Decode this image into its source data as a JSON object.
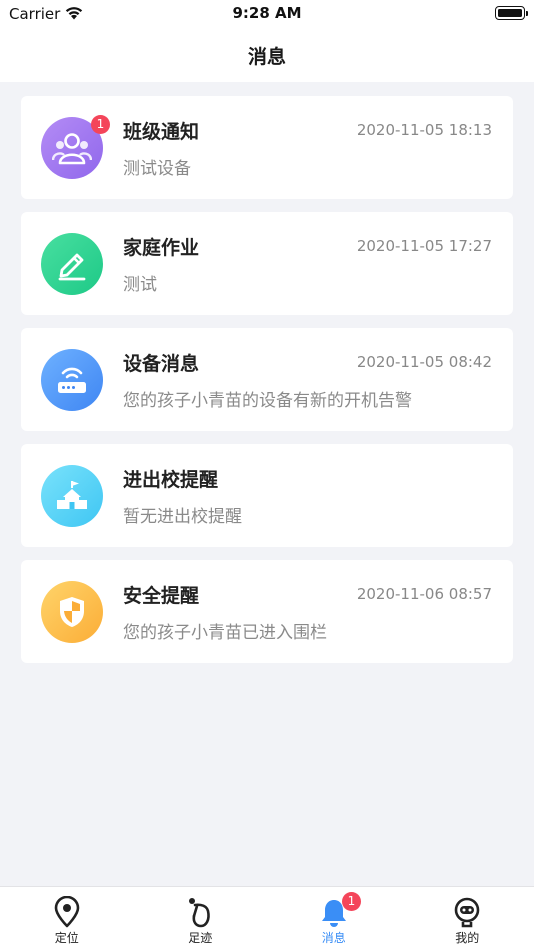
{
  "status_bar": {
    "carrier": "Carrier",
    "time": "9:28 AM"
  },
  "nav": {
    "title": "消息"
  },
  "messages": [
    {
      "name": "班级通知",
      "time": "2020-11-05 18:13",
      "desc": "测试设备",
      "badge": "1",
      "icon": "class-group-icon",
      "color": [
        "#b48cf5",
        "#9067ec"
      ]
    },
    {
      "name": "家庭作业",
      "time": "2020-11-05 17:27",
      "desc": "测试",
      "badge": "",
      "icon": "pencil-icon",
      "color": [
        "#48dfa0",
        "#1ec987"
      ]
    },
    {
      "name": "设备消息",
      "time": "2020-11-05 08:42",
      "desc": "您的孩子小青苗的设备有新的开机告警",
      "badge": "",
      "icon": "router-icon",
      "color": [
        "#6eb1ff",
        "#3f86f3"
      ]
    },
    {
      "name": "进出校提醒",
      "time": "",
      "desc": "暂无进出校提醒",
      "badge": "",
      "icon": "school-icon",
      "color": [
        "#79e2fb",
        "#3fc6f3"
      ]
    },
    {
      "name": "安全提醒",
      "time": "2020-11-06 08:57",
      "desc": "您的孩子小青苗已进入围栏",
      "badge": "",
      "icon": "shield-icon",
      "color": [
        "#ffd46a",
        "#fbad37"
      ]
    }
  ],
  "tabs": [
    {
      "label": "定位",
      "icon": "location-pin-icon",
      "active": false
    },
    {
      "label": "足迹",
      "icon": "footprint-icon",
      "active": false
    },
    {
      "label": "消息",
      "icon": "bell-icon",
      "active": true,
      "badge": "1"
    },
    {
      "label": "我的",
      "icon": "profile-icon",
      "active": false
    }
  ],
  "colors": {
    "accent": "#3a8ef6",
    "badge": "#f4455a",
    "background": "#f2f3f7"
  }
}
